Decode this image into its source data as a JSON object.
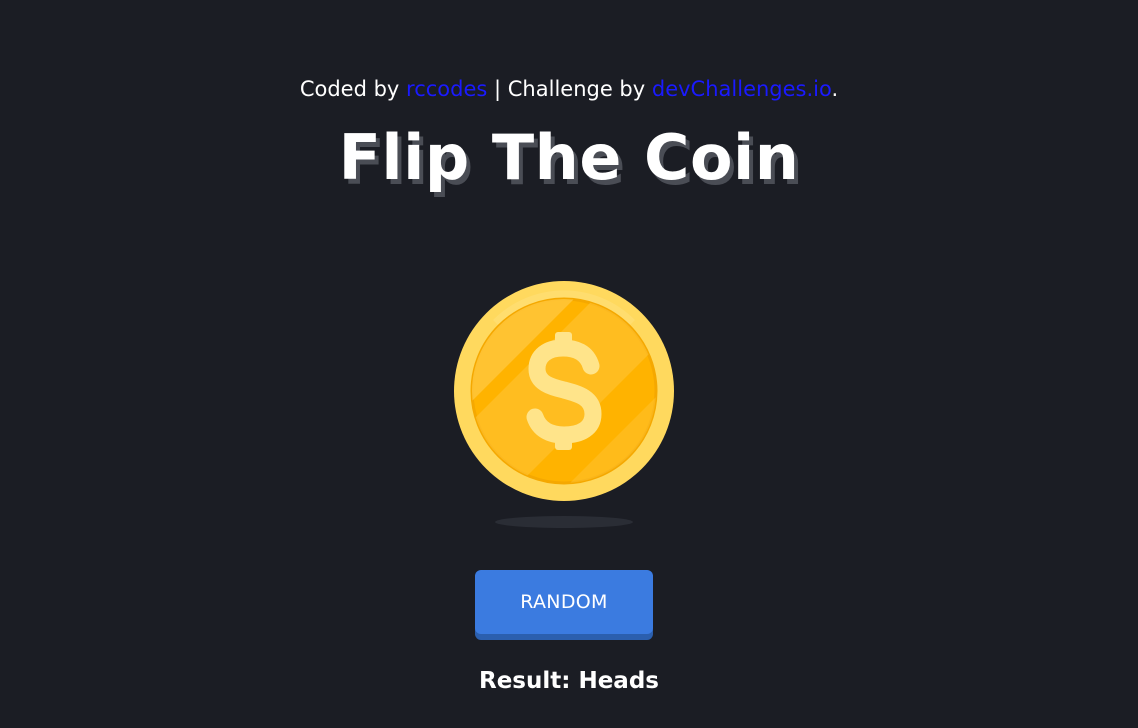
{
  "credits": {
    "prefix": "Coded by ",
    "author_link": "rccodes",
    "separator": " | Challenge by ",
    "challenge_link": "devChallenges.io",
    "suffix": "."
  },
  "title": "Flip The Coin",
  "coin": {
    "icon": "dollar-coin-icon",
    "side": "heads"
  },
  "actions": {
    "random_label": "RANDOM"
  },
  "result": {
    "text": "Result: Heads"
  },
  "colors": {
    "background": "#1b1d24",
    "button": "#3b7be0",
    "link": "#1a1aff",
    "coin_outer": "#ffd95e",
    "coin_inner": "#ffb300"
  }
}
